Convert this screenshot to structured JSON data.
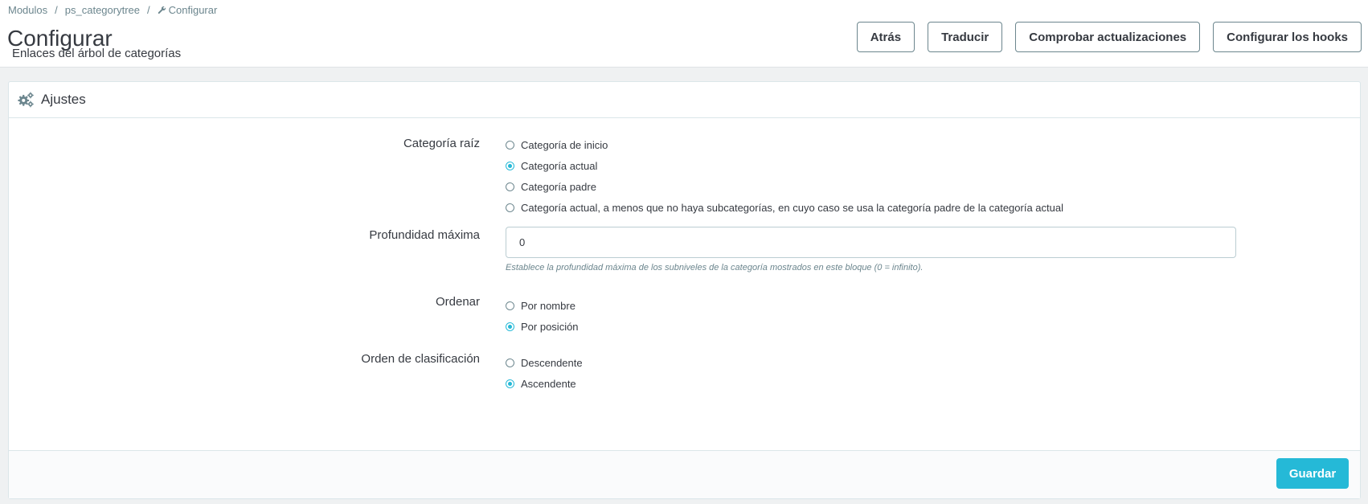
{
  "breadcrumb": {
    "items": [
      "Modulos",
      "ps_categorytree",
      "Configurar"
    ],
    "separator": "/"
  },
  "header": {
    "title": "Configurar",
    "subtitle": "Enlaces del árbol de categorías",
    "buttons": {
      "back": "Atrás",
      "translate": "Traducir",
      "check_updates": "Comprobar actualizaciones",
      "configure_hooks": "Configurar los hooks"
    }
  },
  "panel": {
    "heading": "Ajustes",
    "heading_icon": "cogs-icon",
    "root_category": {
      "label": "Categoría raíz",
      "options": [
        "Categoría de inicio",
        "Categoría actual",
        "Categoría padre",
        "Categoría actual, a menos que no haya subcategorías, en cuyo caso se usa la categoría padre de la categoría actual"
      ],
      "selected": 1
    },
    "max_depth": {
      "label": "Profundidad máxima",
      "value": "0",
      "help": "Establece la profundidad máxima de los subniveles de la categoría mostrados en este bloque (0 = infinito)."
    },
    "sort": {
      "label": "Ordenar",
      "options": [
        "Por nombre",
        "Por posición"
      ],
      "selected": 1
    },
    "sort_order": {
      "label": "Orden de clasificación",
      "options": [
        "Descendente",
        "Ascendente"
      ],
      "selected": 1
    },
    "save_label": "Guardar"
  },
  "colors": {
    "accent": "#25b9d7",
    "text": "#363a41",
    "muted": "#6c868e",
    "background": "#eff1f2"
  }
}
